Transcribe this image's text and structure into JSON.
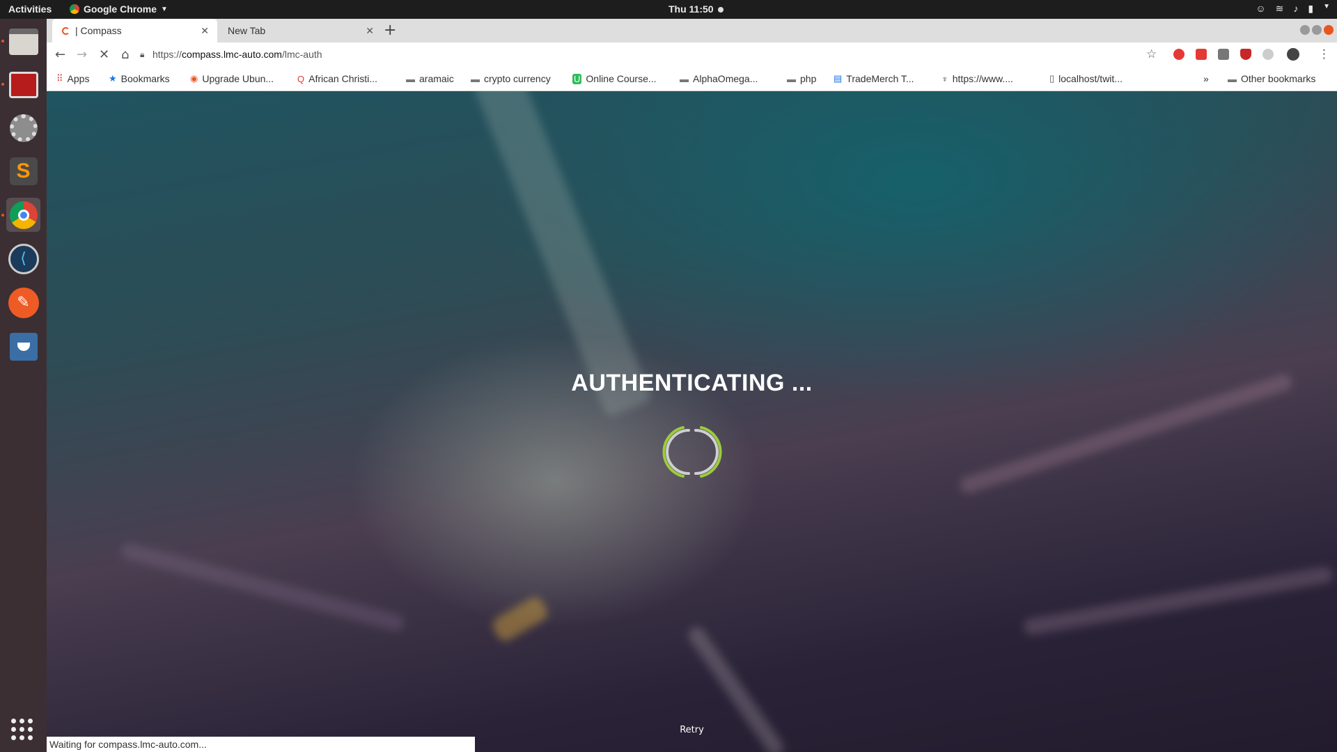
{
  "topbar": {
    "activities": "Activities",
    "app_name": "Google Chrome",
    "clock": "Thu 11:50"
  },
  "tabs": [
    {
      "label": "| Compass"
    },
    {
      "label": "New Tab"
    }
  ],
  "address_bar": {
    "scheme": "https://",
    "host": "compass.lmc-auto.com",
    "path": "/lmc-auth"
  },
  "bookmarks": [
    {
      "label": "Apps",
      "icon": "apps-grid-icon"
    },
    {
      "label": "Bookmarks",
      "icon": "star-icon"
    },
    {
      "label": "Upgrade Ubun...",
      "icon": "ubuntu-icon"
    },
    {
      "label": "African Christi...",
      "icon": "red-q-icon"
    },
    {
      "label": "aramaic",
      "icon": "folder-icon"
    },
    {
      "label": "crypto currency",
      "icon": "folder-icon"
    },
    {
      "label": "Online Course...",
      "icon": "udemy-icon"
    },
    {
      "label": "AlphaOmega...",
      "icon": "folder-icon"
    },
    {
      "label": "php",
      "icon": "folder-icon"
    },
    {
      "label": "TradeMerch T...",
      "icon": "doc-icon"
    },
    {
      "label": "https://www....",
      "icon": "trophy-icon"
    },
    {
      "label": "localhost/twit...",
      "icon": "page-icon"
    }
  ],
  "other_bookmarks": "Other bookmarks",
  "overflow": "»",
  "page": {
    "title": "AUTHENTICATING ...",
    "retry": "Retry"
  },
  "status_bar": "Waiting for compass.lmc-auto.com..."
}
